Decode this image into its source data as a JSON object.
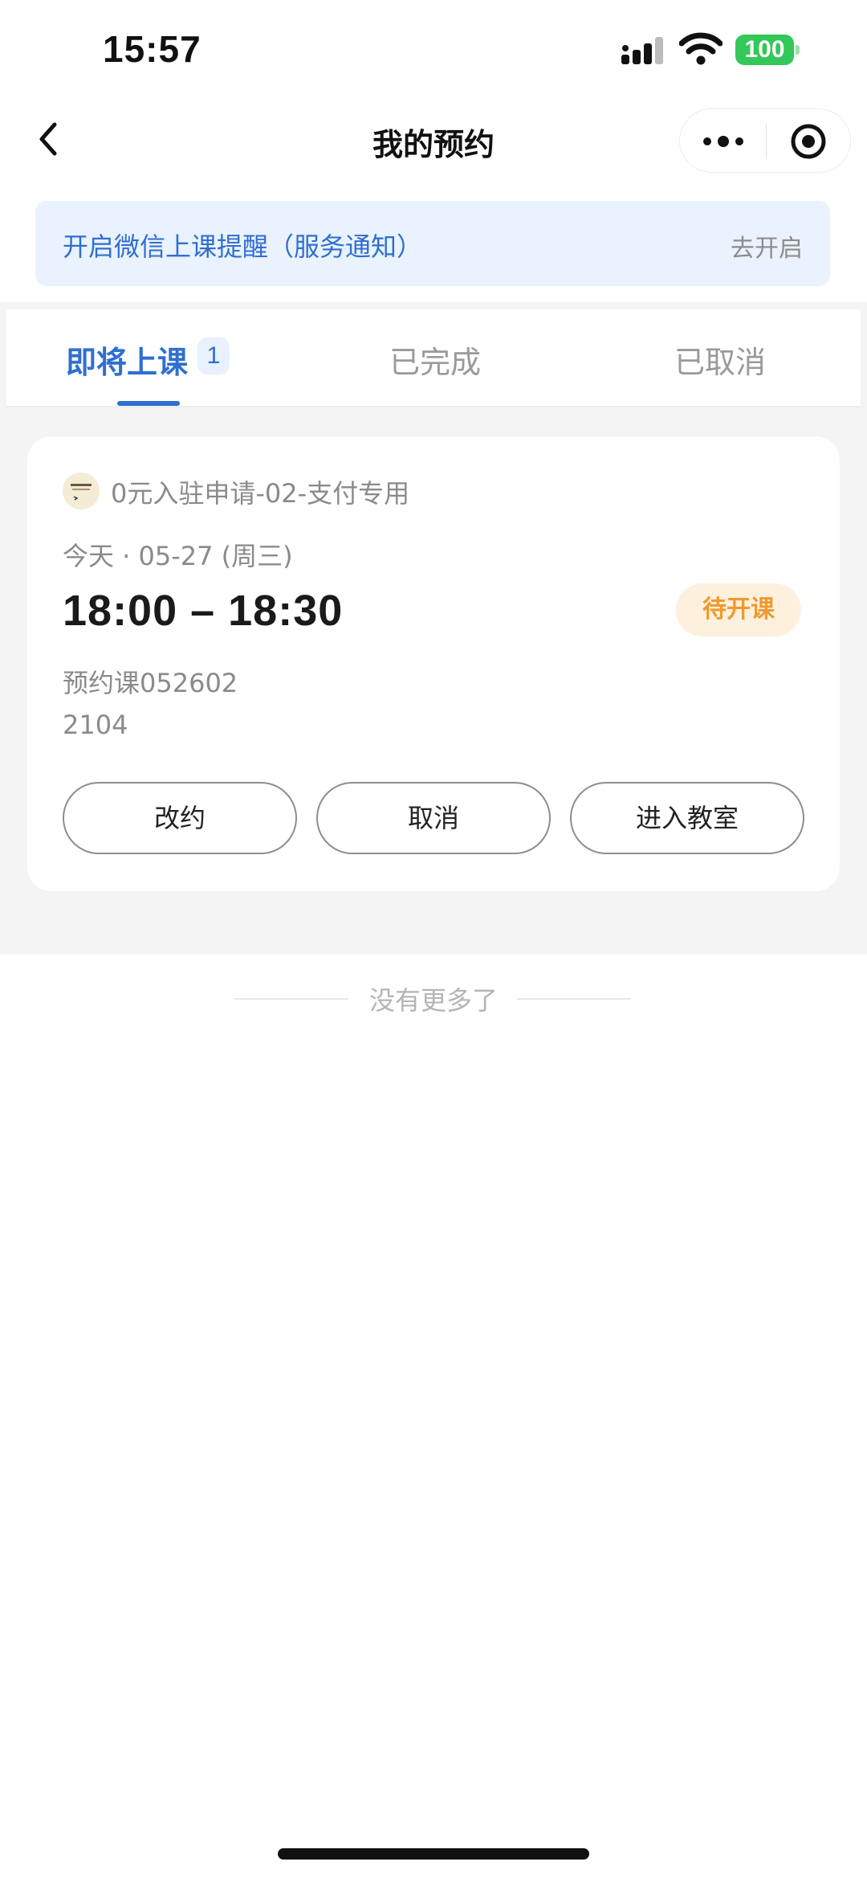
{
  "status_bar": {
    "time": "15:57",
    "battery": "100",
    "icons": [
      "signal-icon",
      "wifi-icon",
      "battery-icon"
    ]
  },
  "nav": {
    "title": "我的预约",
    "icons": [
      "back-chevron-icon",
      "more-dots-icon",
      "target-icon"
    ]
  },
  "reminder": {
    "text": "开启微信上课提醒（服务通知）",
    "action": "去开启"
  },
  "tabs": {
    "upcoming": "即将上课",
    "upcoming_count": "1",
    "completed": "已完成",
    "cancelled": "已取消",
    "active": "upcoming"
  },
  "booking": {
    "store_name": "0元入驻申请-02-支付专用",
    "date": "今天 · 05-27 (周三)",
    "time": "18:00 – 18:30",
    "status": "待开课",
    "course": "预约课052602",
    "room": "2104",
    "buttons": {
      "reschedule": "改约",
      "cancel": "取消",
      "enter": "进入教室"
    }
  },
  "footer": {
    "no_more": "没有更多了"
  },
  "colors": {
    "accent": "#2f6fd0",
    "status_orange": "#ef9a2e",
    "battery_green": "#34c759",
    "background_grey": "#f4f4f4"
  }
}
